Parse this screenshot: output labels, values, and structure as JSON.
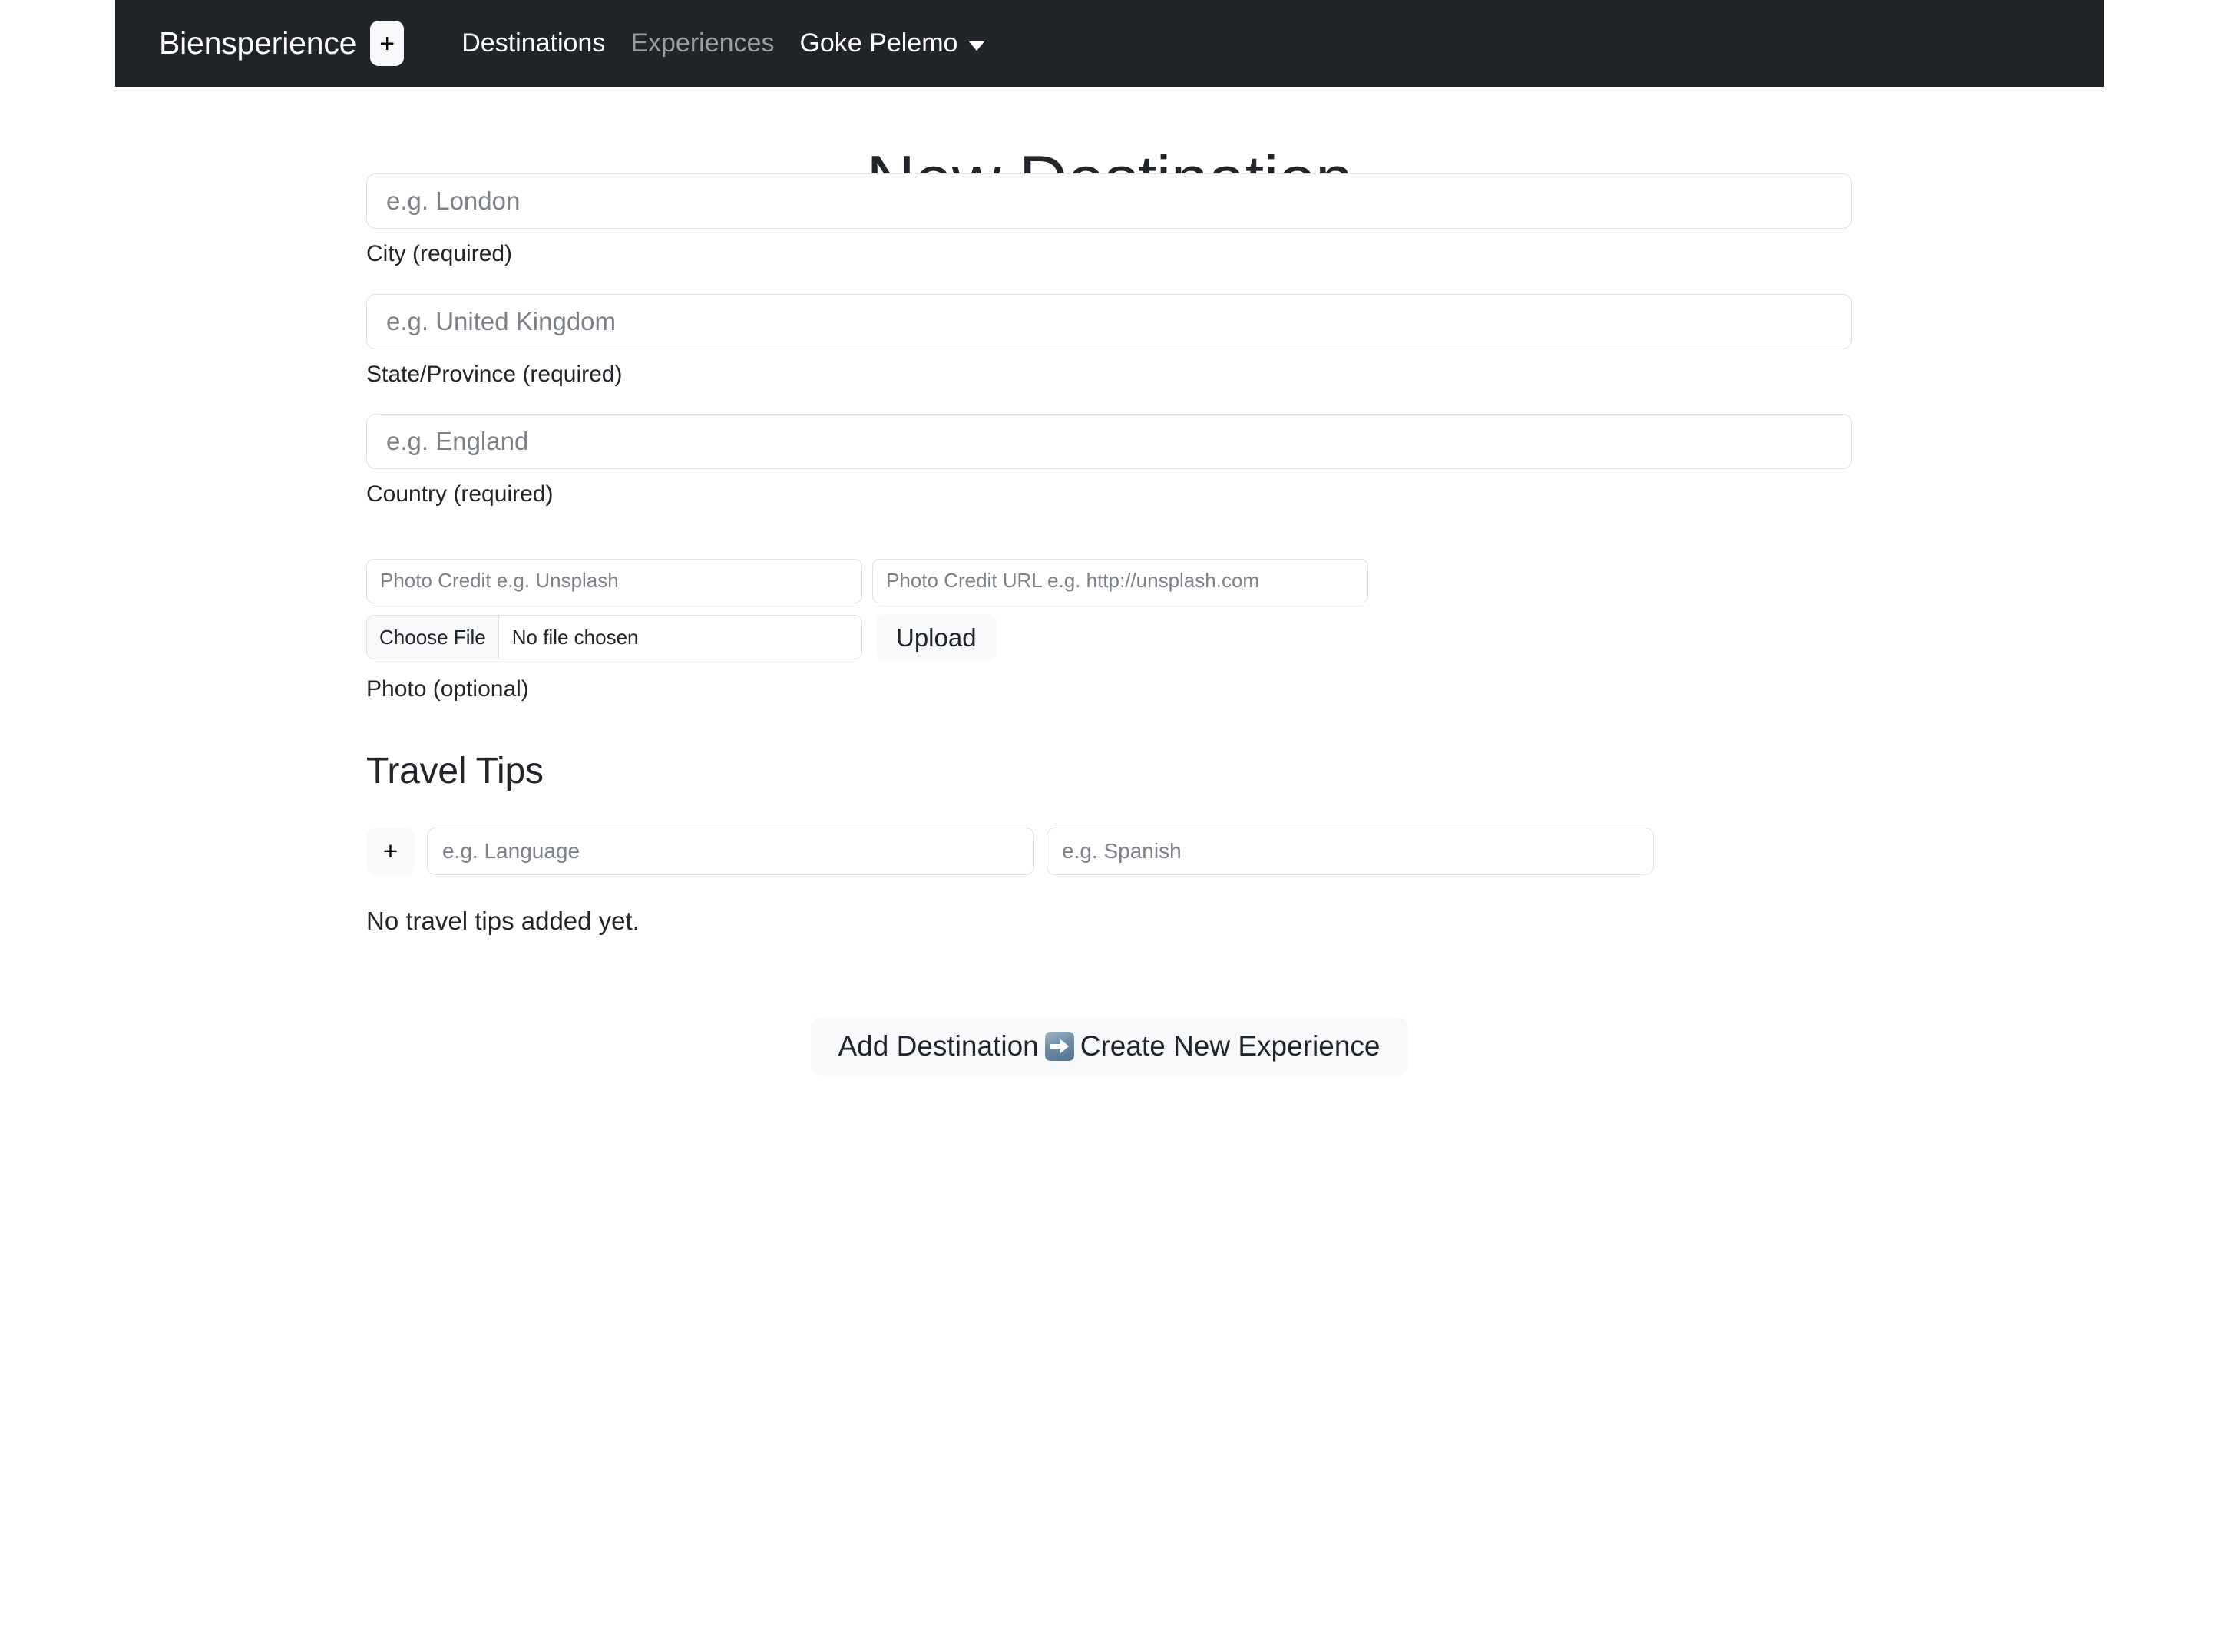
{
  "navbar": {
    "brand": "Biensperience",
    "add_button_label": "+",
    "add_button_icon": "plus-icon",
    "links": [
      {
        "label": "Destinations",
        "state": "active"
      },
      {
        "label": "Experiences",
        "state": "muted"
      }
    ],
    "user_menu": {
      "label": "Goke Pelemo",
      "caret_icon": "chevron-down-icon"
    },
    "background_color": "#212529",
    "text_color": "#ffffff"
  },
  "main": {
    "title": "New Destination",
    "fields": [
      {
        "placeholder": "e.g. London",
        "value": "",
        "label": "City (required)"
      },
      {
        "placeholder": "e.g. United Kingdom",
        "value": "",
        "label": "State/Province (required)"
      },
      {
        "placeholder": "e.g. England",
        "value": "",
        "label": "Country (required)"
      }
    ],
    "photo": {
      "credit_placeholder": "Photo Credit e.g. Unsplash",
      "credit_value": "",
      "credit_url_placeholder": "Photo Credit URL e.g. http://unsplash.com",
      "credit_url_value": "",
      "choose_file_label": "Choose File",
      "file_status": "No file chosen",
      "upload_label": "Upload",
      "label": "Photo (optional)"
    },
    "travel_tips": {
      "heading": "Travel Tips",
      "add_button_label": "+",
      "add_button_icon": "plus-icon",
      "key_placeholder": "e.g. Language",
      "key_value": "",
      "value_placeholder": "e.g. Spanish",
      "value_value": "",
      "empty_message": "No travel tips added yet."
    },
    "submit": {
      "text_before": "Add Destination",
      "emoji_icon": "right-arrow-emoji-icon",
      "text_after": "Create New Experience"
    }
  },
  "colors": {
    "navbar_bg": "#212529",
    "body_bg": "#ffffff",
    "border": "#dee2e6",
    "placeholder": "#7b8187",
    "button_bg": "#f8f9fa",
    "text": "#212529"
  }
}
